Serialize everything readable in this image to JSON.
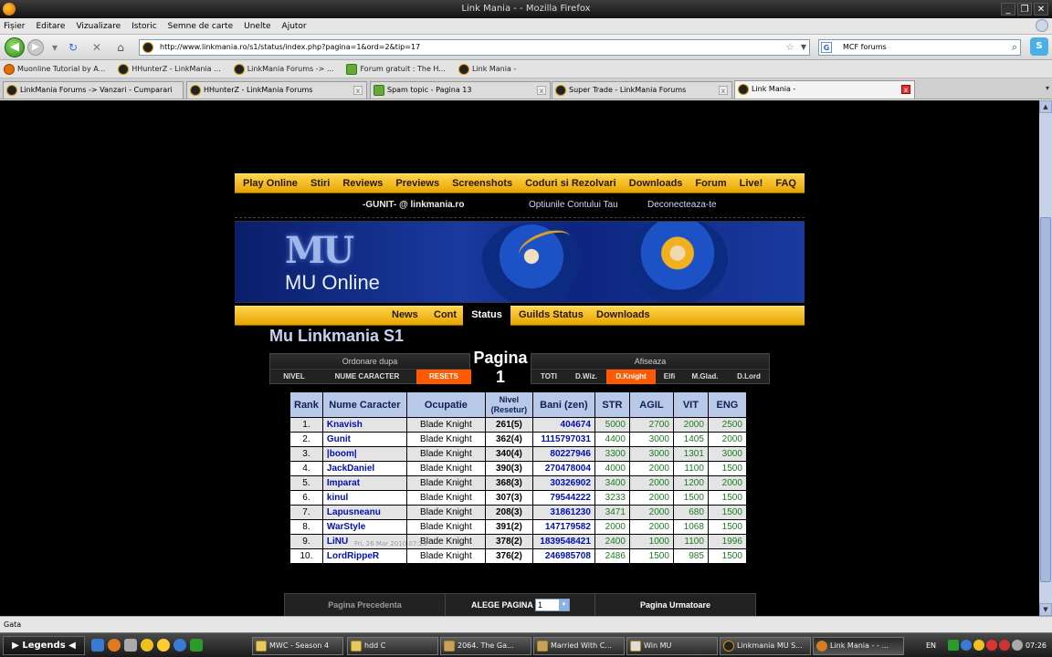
{
  "window": {
    "title": "Link Mania - - Mozilla Firefox"
  },
  "menu": [
    "Fișier",
    "Editare",
    "Vizualizare",
    "Istoric",
    "Semne de carte",
    "Unelte",
    "Ajutor"
  ],
  "nav": {
    "url": "http://www.linkmania.ro/s1/status/index.php?pagina=1&ord=2&tip=17",
    "search_value": "MCF forums"
  },
  "bookmarks": [
    "Muonline Tutorial by A...",
    "HHunterZ - LinkMania ...",
    "LinkMania Forums -> ...",
    "Forum gratuit : The H...",
    "Link Mania -"
  ],
  "tabs": [
    "LinkMania Forums -> Vanzari - Cumparari",
    "HHunterZ - LinkMania Forums",
    "Spam topic - Pagina 13",
    "Super Trade - LinkMania Forums",
    "Link Mania -"
  ],
  "site": {
    "topnav": [
      "Play Online",
      "Stiri",
      "Reviews",
      "Previews",
      "Screenshots",
      "Coduri si Rezolvari",
      "Downloads",
      "Forum",
      "Live!",
      "FAQ"
    ],
    "user": "-GUNIT- @ linkmania.ro",
    "account_options": "Optiunile Contului Tau",
    "logout": "Deconecteaza-te",
    "banner_logo": "MU",
    "banner_name": "MU Online",
    "subnav": [
      "News",
      "Cont",
      "Status",
      "Guilds Status",
      "Downloads"
    ],
    "page_title": "Mu Linkmania S1",
    "sort_header": "Ordonare dupa",
    "sort_options": [
      "NIVEL",
      "NUME CARACTER",
      "RESETS"
    ],
    "pagina_label": "Pagina",
    "pagina_num": "1",
    "filter_header": "Afiseaza",
    "filter_options": [
      "TOTI",
      "D.Wiz.",
      "D.Knight",
      "Elfi",
      "M.Glad.",
      "D.Lord"
    ],
    "table_headers": {
      "rank": "Rank",
      "name": "Nume Caracter",
      "occ": "Ocupatie",
      "lvl1": "Nivel",
      "lvl2": "(Resetur)",
      "zen": "Bani (zen)",
      "str": "STR",
      "agil": "AGIL",
      "vit": "VIT",
      "eng": "ENG"
    },
    "rows": [
      {
        "rank": "1.",
        "name": "Knavish",
        "occ": "Blade Knight",
        "lvl": "261(5)",
        "zen": "404674",
        "str": "5000",
        "agil": "2700",
        "vit": "2000",
        "eng": "2500"
      },
      {
        "rank": "2.",
        "name": "Gunit",
        "occ": "Blade Knight",
        "lvl": "362(4)",
        "zen": "1115797031",
        "str": "4400",
        "agil": "3000",
        "vit": "1405",
        "eng": "2000"
      },
      {
        "rank": "3.",
        "name": "|boom|",
        "occ": "Blade Knight",
        "lvl": "340(4)",
        "zen": "80227946",
        "str": "3300",
        "agil": "3000",
        "vit": "1301",
        "eng": "3000"
      },
      {
        "rank": "4.",
        "name": "JackDaniel",
        "occ": "Blade Knight",
        "lvl": "390(3)",
        "zen": "270478004",
        "str": "4000",
        "agil": "2000",
        "vit": "1100",
        "eng": "1500"
      },
      {
        "rank": "5.",
        "name": "Imparat",
        "occ": "Blade Knight",
        "lvl": "368(3)",
        "zen": "30326902",
        "str": "3400",
        "agil": "2000",
        "vit": "1200",
        "eng": "2000"
      },
      {
        "rank": "6.",
        "name": "kinul",
        "occ": "Blade Knight",
        "lvl": "307(3)",
        "zen": "79544222",
        "str": "3233",
        "agil": "2000",
        "vit": "1500",
        "eng": "1500"
      },
      {
        "rank": "7.",
        "name": "Lapusneanu",
        "occ": "Blade Knight",
        "lvl": "208(3)",
        "zen": "31861230",
        "str": "3471",
        "agil": "2000",
        "vit": "680",
        "eng": "1500"
      },
      {
        "rank": "8.",
        "name": "WarStyle",
        "occ": "Blade Knight",
        "lvl": "391(2)",
        "zen": "147179582",
        "str": "2000",
        "agil": "2000",
        "vit": "1068",
        "eng": "1500"
      },
      {
        "rank": "9.",
        "name": "LiNU",
        "occ": "Blade Knight",
        "lvl": "378(2)",
        "zen": "1839548421",
        "str": "2400",
        "agil": "1000",
        "vit": "1100",
        "eng": "1996"
      },
      {
        "rank": "10.",
        "name": "LordRippeR",
        "occ": "Blade Knight",
        "lvl": "376(2)",
        "zen": "246985708",
        "str": "2486",
        "agil": "1500",
        "vit": "985",
        "eng": "1500"
      }
    ],
    "watermark": "Fri, 26 Mar 2010 07:26",
    "pager": {
      "prev": "Pagina Precedenta",
      "choose": "ALEGE PAGINA",
      "select_value": "1",
      "next": "Pagina Urmatoare"
    }
  },
  "status": "Gata",
  "taskbar": {
    "start": "Legends",
    "items": [
      "MWC - Season 4",
      "hdd C",
      "2064. The Ga...",
      "Married With C...",
      "Win MU",
      "Linkmania MU S...",
      "Link Mania - - ..."
    ],
    "lang": "EN",
    "clock": "07:26"
  },
  "colors": {
    "gold": "#e6a500",
    "orange_active": "#ff5a00",
    "header_blue": "#b8c8e8",
    "link_blue": "#0010b0",
    "stat_green": "#1f7a1f"
  }
}
